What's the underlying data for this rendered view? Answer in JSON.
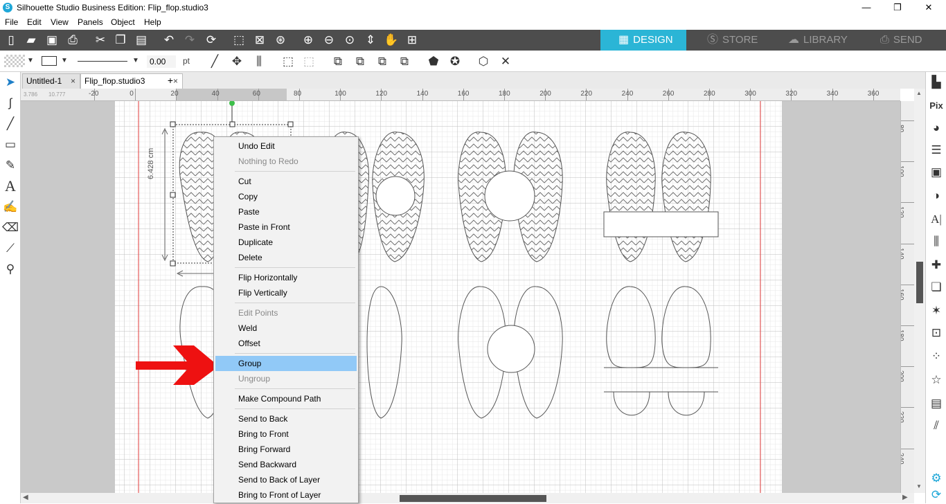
{
  "window": {
    "title": "Silhouette Studio Business Edition: Flip_flop.studio3",
    "app_icon": "S",
    "minimize": "—",
    "restore": "❐",
    "close": "✕"
  },
  "menu": [
    "File",
    "Edit",
    "View",
    "Panels",
    "Object",
    "Help"
  ],
  "modes": [
    {
      "label": "DESIGN",
      "icon": "design-icon",
      "active": true
    },
    {
      "label": "STORE",
      "icon": "store-icon",
      "active": false
    },
    {
      "label": "LIBRARY",
      "icon": "library-icon",
      "active": false
    },
    {
      "label": "SEND",
      "icon": "send-icon",
      "active": false
    }
  ],
  "line_toolbar": {
    "line_width_value": "0.00",
    "line_width_unit": "pt"
  },
  "tabs": [
    {
      "label": "Untitled-1",
      "close": "×"
    },
    {
      "label": "Flip_flop.studio3",
      "close": "×"
    }
  ],
  "new_tab": "+",
  "ruler": {
    "horizontal_ticks": [
      "-20",
      "0",
      "20",
      "40",
      "60",
      "80",
      "100",
      "120",
      "140",
      "160",
      "180",
      "200",
      "220",
      "240",
      "260",
      "280",
      "300",
      "320",
      "340",
      "360"
    ],
    "vertical_ticks": [
      "80",
      "100",
      "120",
      "140",
      "160",
      "180",
      "200",
      "220",
      "240"
    ],
    "coords_x": "3.786",
    "coords_y": "10.777"
  },
  "selection": {
    "height_label": "6.428 cm"
  },
  "context_menu": {
    "groups": [
      [
        {
          "label": "Undo Edit",
          "enabled": true
        },
        {
          "label": "Nothing to Redo",
          "enabled": false
        }
      ],
      [
        {
          "label": "Cut",
          "enabled": true
        },
        {
          "label": "Copy",
          "enabled": true
        },
        {
          "label": "Paste",
          "enabled": true
        },
        {
          "label": "Paste in Front",
          "enabled": true
        },
        {
          "label": "Duplicate",
          "enabled": true
        },
        {
          "label": "Delete",
          "enabled": true
        }
      ],
      [
        {
          "label": "Flip Horizontally",
          "enabled": true
        },
        {
          "label": "Flip Vertically",
          "enabled": true
        }
      ],
      [
        {
          "label": "Edit Points",
          "enabled": false
        },
        {
          "label": "Weld",
          "enabled": true
        },
        {
          "label": "Offset",
          "enabled": true
        }
      ],
      [
        {
          "label": "Group",
          "enabled": true,
          "highlighted": true
        },
        {
          "label": "Ungroup",
          "enabled": false
        }
      ],
      [
        {
          "label": "Make Compound Path",
          "enabled": true
        }
      ],
      [
        {
          "label": "Send to Back",
          "enabled": true
        },
        {
          "label": "Bring to Front",
          "enabled": true
        },
        {
          "label": "Bring Forward",
          "enabled": true
        },
        {
          "label": "Send Backward",
          "enabled": true
        },
        {
          "label": "Send to Back of Layer",
          "enabled": true
        },
        {
          "label": "Bring to Front of Layer",
          "enabled": true
        }
      ]
    ]
  },
  "colors": {
    "toolbar_dark": "#4d4d4d",
    "design_active": "#2bb5d6",
    "menu_highlight": "#91c9f7",
    "arrow": "#ee1111",
    "cut_border": "#e23b3b"
  }
}
